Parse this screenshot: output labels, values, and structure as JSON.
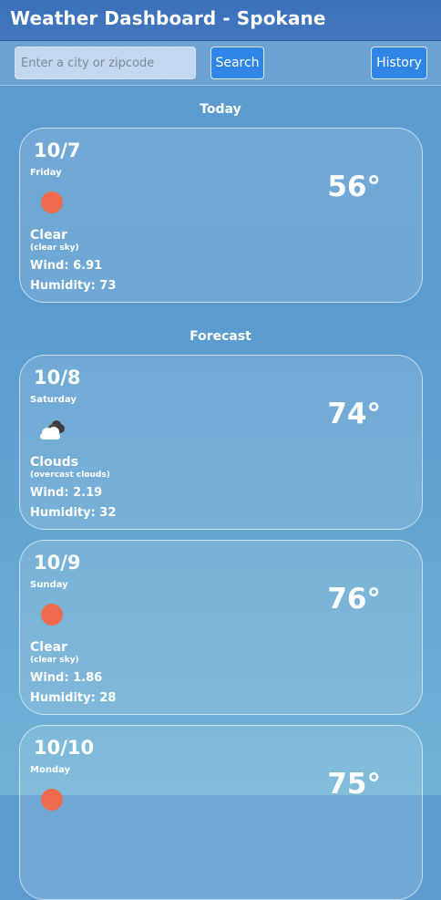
{
  "header": {
    "title": "Weather Dashboard - Spokane"
  },
  "search": {
    "placeholder": "Enter a city or zipcode",
    "value": "",
    "button_label": "Search"
  },
  "history": {
    "button_label": "History"
  },
  "sections": {
    "today": "Today",
    "forecast": "Forecast"
  },
  "today": {
    "date": "10/7",
    "weekday": "Friday",
    "icon": "sun-icon",
    "condition": "Clear",
    "description": "(clear sky)",
    "wind": "Wind: 6.91",
    "humidity": "Humidity: 73",
    "temp": "56°"
  },
  "forecast": [
    {
      "date": "10/8",
      "weekday": "Saturday",
      "icon": "clouds-icon",
      "condition": "Clouds",
      "description": "(overcast clouds)",
      "wind": "Wind: 2.19",
      "humidity": "Humidity: 32",
      "temp": "74°"
    },
    {
      "date": "10/9",
      "weekday": "Sunday",
      "icon": "sun-icon",
      "condition": "Clear",
      "description": "(clear sky)",
      "wind": "Wind: 1.86",
      "humidity": "Humidity: 28",
      "temp": "76°"
    },
    {
      "date": "10/10",
      "weekday": "Monday",
      "icon": "sun-icon",
      "condition": "",
      "description": "",
      "wind": "",
      "humidity": "",
      "temp": "75°"
    }
  ],
  "colors": {
    "sun": "#ee6b4d",
    "button": "#2f86e6",
    "header": "#3d72bc"
  }
}
